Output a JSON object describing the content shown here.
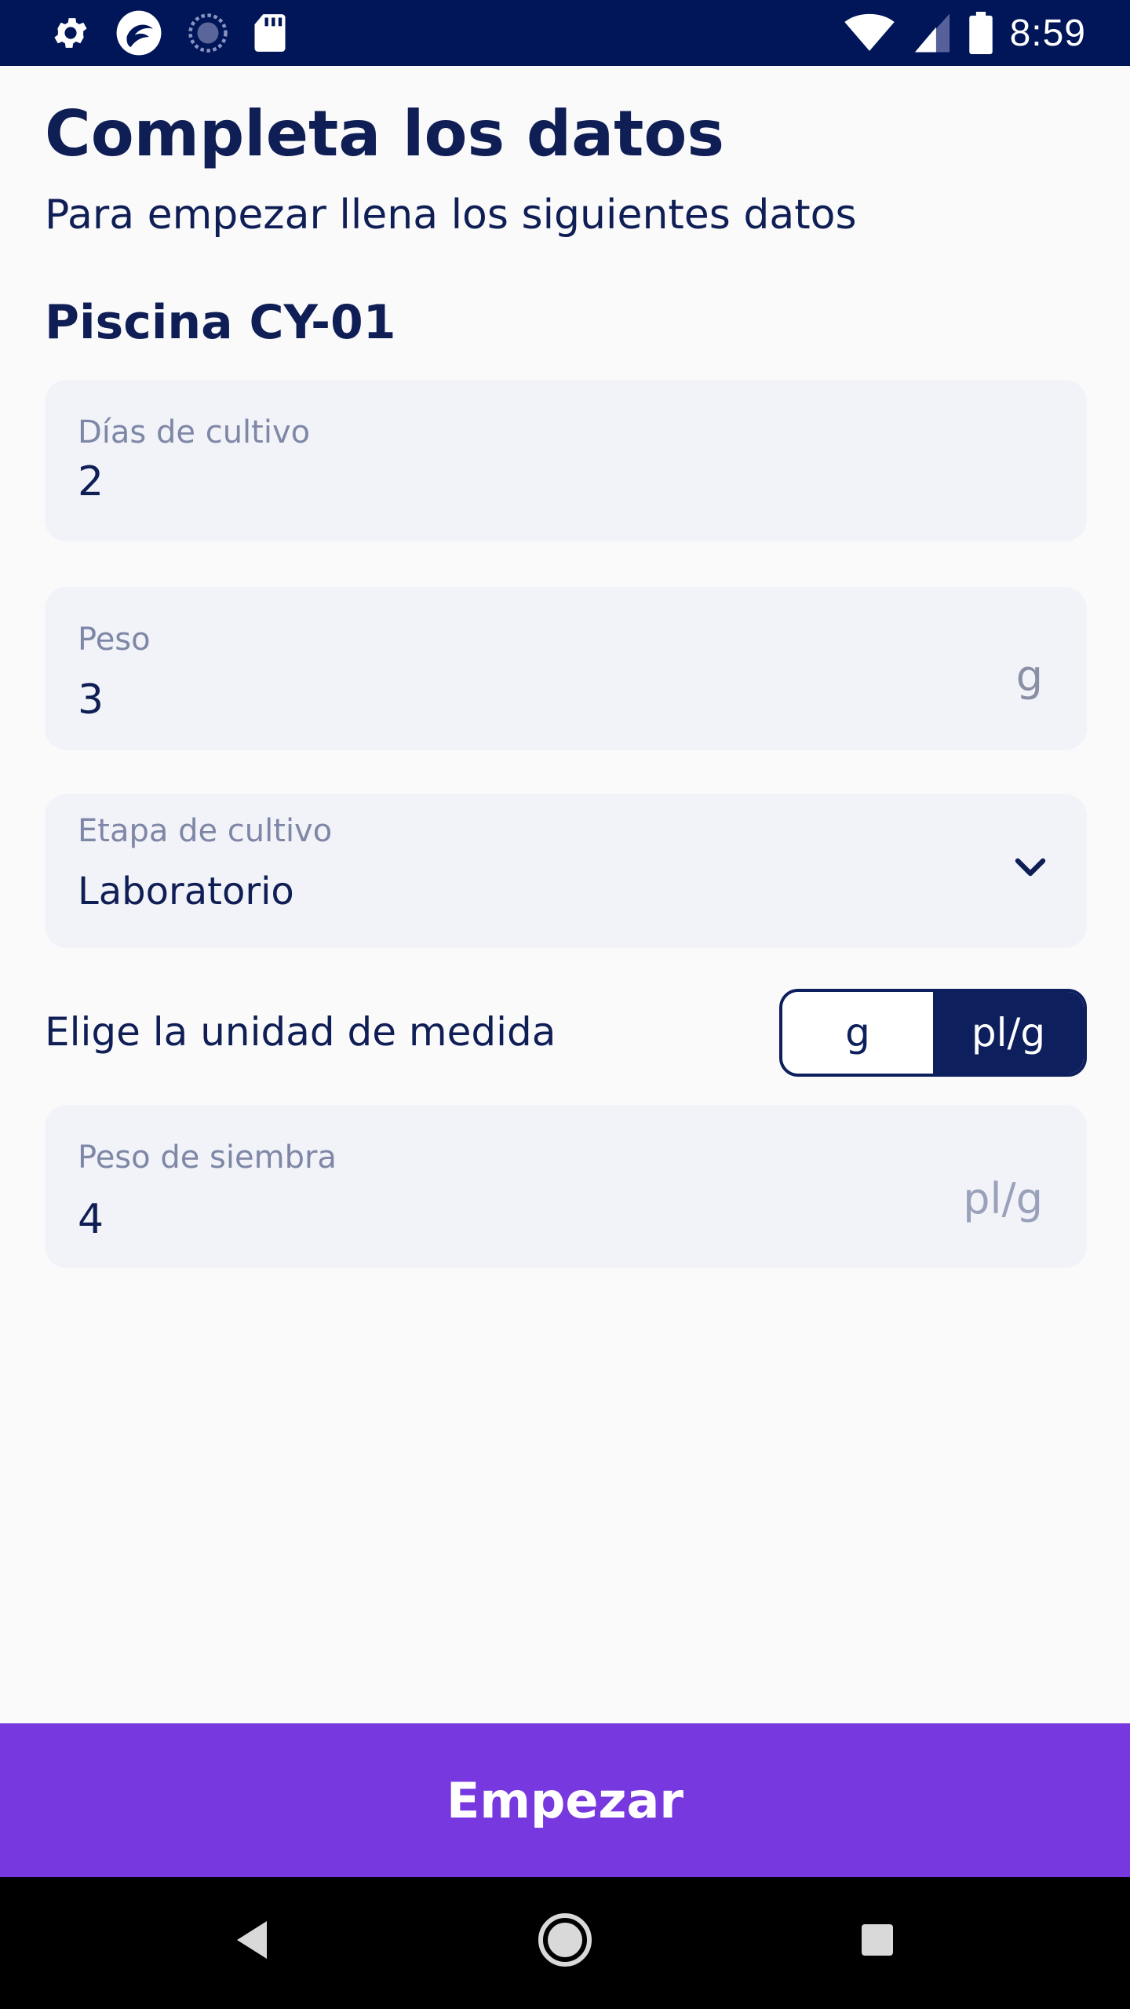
{
  "status_bar": {
    "time": "8:59",
    "left_icons": [
      "settings-icon",
      "app-icon",
      "sync-icon",
      "sd-card-icon"
    ],
    "right_icons": [
      "wifi-icon",
      "signal-icon",
      "battery-icon"
    ]
  },
  "header": {
    "title": "Completa los datos",
    "subtitle": "Para empezar llena los siguientes datos"
  },
  "pool": {
    "name": "Piscina CY-01"
  },
  "fields": {
    "culture_days": {
      "label": "Días de cultivo",
      "value": "2"
    },
    "weight": {
      "label": "Peso",
      "value": "3",
      "unit": "g"
    },
    "stage": {
      "label": "Etapa de cultivo",
      "value": "Laboratorio"
    },
    "seed_weight": {
      "label": "Peso de siembra",
      "value": "4",
      "unit": "pl/g"
    }
  },
  "unit_selector": {
    "label": "Elige la unidad de medida",
    "options": [
      "g",
      "pl/g"
    ],
    "selected": "pl/g"
  },
  "actions": {
    "start_label": "Empezar"
  },
  "colors": {
    "status_bar": "#001659",
    "primary_text": "#0F1E55",
    "field_bg": "#F2F3F8",
    "accent": "#7738E0",
    "toggle_active": "#0D1F5C"
  }
}
